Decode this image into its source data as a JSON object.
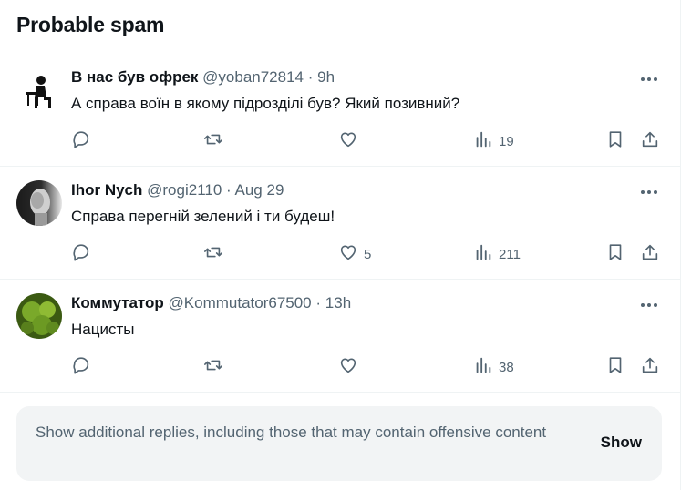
{
  "section": {
    "title": "Probable spam"
  },
  "posts": [
    {
      "name": "В нас був офрек",
      "handle": "@yoban72814",
      "sep": "·",
      "time": "9h",
      "text": "А справа воїн в якому підрозділі був? Який позивний?",
      "likes": "",
      "views": "19"
    },
    {
      "name": "Ihor Nych",
      "handle": "@rogi2110",
      "sep": "·",
      "time": "Aug 29",
      "text": "Справа перегній зелений і ти будеш!",
      "likes": "5",
      "views": "211"
    },
    {
      "name": "Коммутатор",
      "handle": "@Kommutator67500",
      "sep": "·",
      "time": "13h",
      "text": "Нацисты",
      "likes": "",
      "views": "38"
    }
  ],
  "spam_notice": {
    "text": "Show additional replies, including those that may contain offensive content",
    "button": "Show"
  },
  "icons": {
    "more": "more-horizontal-icon",
    "reply": "reply-bubble-icon",
    "retweet": "repost-arrows-icon",
    "like": "heart-icon",
    "views": "views-bar-chart-icon",
    "bookmark": "bookmark-icon",
    "share": "share-upload-icon"
  },
  "colors": {
    "text": "#0f1419",
    "muted": "#536471",
    "divider": "#eff3f4",
    "notice_bg": "#f2f4f5"
  }
}
